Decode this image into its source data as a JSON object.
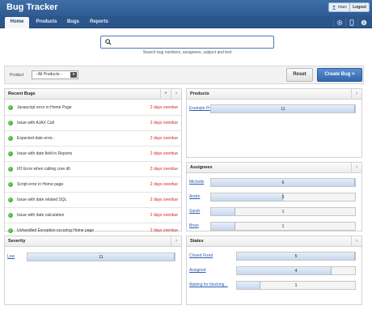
{
  "app": {
    "title": "Bug Tracker"
  },
  "user": {
    "name": "marc",
    "logout": "Logout"
  },
  "nav": {
    "tabs": [
      "Home",
      "Products",
      "Bugs",
      "Reports"
    ],
    "active": "Home"
  },
  "search": {
    "placeholder": "",
    "hint": "Search bug numbers, assignees, subject and text"
  },
  "filter": {
    "label": "Product",
    "selected": "- All Products -",
    "reset": "Reset",
    "create": "Create Bug >"
  },
  "recent_bugs": {
    "title": "Recent Bugs",
    "items": [
      {
        "title": "Javascript error in Home Page",
        "due": "2 days overdue"
      },
      {
        "title": "Issue with AJAX Call",
        "due": "2 days overdue"
      },
      {
        "title": "Expected date error..",
        "due": "2 days overdue"
      },
      {
        "title": "Issue with date field in Reports",
        "due": "2 days overdue"
      },
      {
        "title": "I/O Error when calling core.dll",
        "due": "2 days overdue"
      },
      {
        "title": "Script error in Home page",
        "due": "2 days overdue"
      },
      {
        "title": "Issue with date related SQL",
        "due": "2 days overdue"
      },
      {
        "title": "Issue with date calculation",
        "due": "2 days overdue"
      },
      {
        "title": "Unhandled Exception occuring Home page",
        "due": "2 days overdue"
      }
    ]
  },
  "products": {
    "title": "Products",
    "rows": [
      {
        "label": "Example Product",
        "value": 11,
        "fill": 1.0
      }
    ]
  },
  "assignees": {
    "title": "Assignees",
    "rows": [
      {
        "label": "Michelle",
        "value": 6,
        "fill": 1.0
      },
      {
        "label": "Andre",
        "value": 3,
        "fill": 0.5
      },
      {
        "label": "Sarah",
        "value": 1,
        "fill": 0.17
      },
      {
        "label": "Brian",
        "value": 1,
        "fill": 0.17
      }
    ]
  },
  "severity": {
    "title": "Severity",
    "rows": [
      {
        "label": "Low",
        "value": 11,
        "fill": 1.0
      }
    ]
  },
  "states": {
    "title": "States",
    "rows": [
      {
        "label": "Closed Fixed",
        "value": 5,
        "fill": 1.0
      },
      {
        "label": "Assigned",
        "value": 4,
        "fill": 0.8
      },
      {
        "label": "Waiting for blocking...",
        "value": 1,
        "fill": 0.2
      }
    ]
  },
  "colors": {
    "header": "#2e5b91",
    "accent": "#3468ad",
    "overdue": "#d42020",
    "status_dot": "#2c9b23"
  }
}
